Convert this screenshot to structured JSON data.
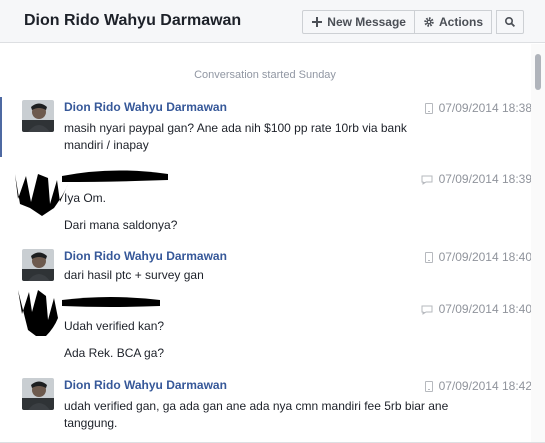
{
  "header": {
    "title": "Dion Rido Wahyu Darmawan",
    "new_message": "New Message",
    "actions": "Actions"
  },
  "conversation": {
    "started": "Conversation started Sunday",
    "messages": [
      {
        "sender": "Dion Rido Wahyu Darmawan",
        "time": "07/09/2014 18:38",
        "lines": [
          "masih nyari paypal gan? Ane ada nih $100 pp rate 10rb via bank",
          "mandiri / inapay"
        ]
      },
      {
        "sender": "",
        "time": "07/09/2014 18:39",
        "lines": [
          "Iya Om.",
          "Dari mana saldonya?"
        ]
      },
      {
        "sender": "Dion Rido Wahyu Darmawan",
        "time": "07/09/2014 18:40",
        "lines": [
          "dari hasil ptc + survey gan"
        ]
      },
      {
        "sender": "",
        "time": "07/09/2014 18:40",
        "lines": [
          "Udah verified kan?",
          "Ada Rek. BCA ga?"
        ]
      },
      {
        "sender": "Dion Rido Wahyu Darmawan",
        "time": "07/09/2014 18:42",
        "lines": [
          "udah verified gan, ga ada gan ane ada nya cmn mandiri fee 5rb biar ane",
          "tanggung."
        ]
      }
    ]
  },
  "icons": {
    "new_message": "plus-icon",
    "actions": "gear-icon",
    "search": "search-icon",
    "device": "mobile-phone-icon"
  },
  "colors": {
    "sender": "#365899",
    "timestamp": "#90949c",
    "header_bg": "#f6f7f9"
  }
}
